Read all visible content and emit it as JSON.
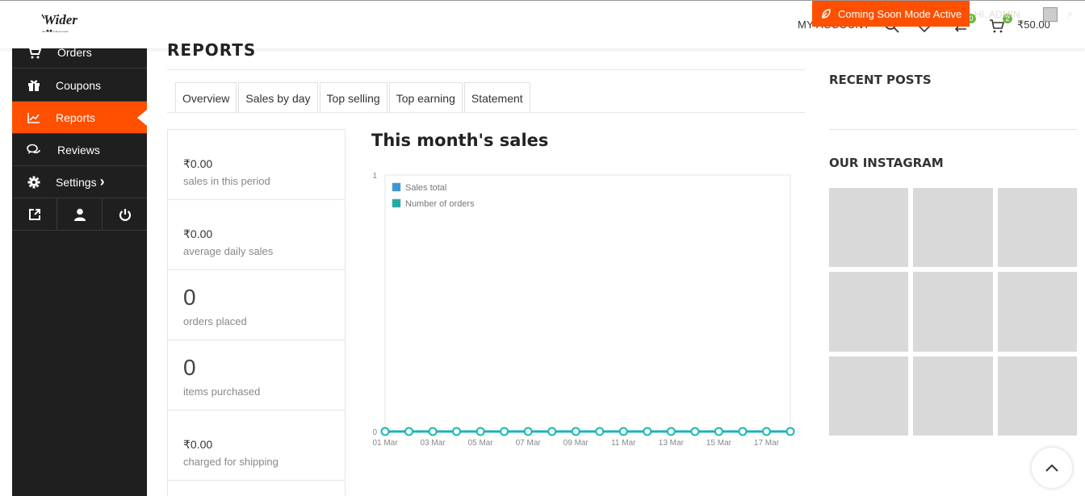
{
  "header": {
    "logo_text": "Wider",
    "logo_tagline": "All in one is all you need",
    "coming_soon": "Coming Soon Mode Active",
    "my_account": "MY ACCOUNT",
    "wishlist_count": "0",
    "cart_count": "2",
    "cart_total": "₹50.00",
    "ghost_text": "HI, ADMIN"
  },
  "sidebar": {
    "items": [
      {
        "label": "Orders",
        "icon": "cart-icon"
      },
      {
        "label": "Coupons",
        "icon": "gift-icon"
      },
      {
        "label": "Reports",
        "icon": "chart-line-icon",
        "active": true
      },
      {
        "label": "Reviews",
        "icon": "chat-icon"
      },
      {
        "label": "Settings",
        "icon": "gear-icon",
        "chevron": "›"
      }
    ],
    "bottom_icons": [
      "external-link-icon",
      "user-icon",
      "power-icon"
    ]
  },
  "page": {
    "title": "REPORTS",
    "tabs": [
      "Overview",
      "Sales by day",
      "Top selling",
      "Top earning",
      "Statement"
    ]
  },
  "stats": [
    {
      "value": "₹0.00",
      "label": "sales in this period"
    },
    {
      "value": "₹0.00",
      "label": "average daily sales"
    },
    {
      "value": "0",
      "label": "orders placed"
    },
    {
      "value": "0",
      "label": "items purchased"
    },
    {
      "value": "₹0.00",
      "label": "charged for shipping"
    }
  ],
  "chart_data": {
    "type": "line",
    "title": "This month's sales",
    "x": [
      "01 Mar",
      "02 Mar",
      "03 Mar",
      "04 Mar",
      "05 Mar",
      "06 Mar",
      "07 Mar",
      "08 Mar",
      "09 Mar",
      "10 Mar",
      "11 Mar",
      "12 Mar",
      "13 Mar",
      "14 Mar",
      "15 Mar",
      "16 Mar",
      "17 Mar",
      "18 Mar"
    ],
    "tick_labels": [
      "01 Mar",
      "03 Mar",
      "05 Mar",
      "07 Mar",
      "09 Mar",
      "11 Mar",
      "13 Mar",
      "15 Mar",
      "17 Mar"
    ],
    "ylim": [
      0,
      1
    ],
    "y_ticks": [
      "0",
      "1"
    ],
    "legend_position": "top-left",
    "series": [
      {
        "name": "Sales total",
        "color": "#3498db",
        "values": [
          0,
          0,
          0,
          0,
          0,
          0,
          0,
          0,
          0,
          0,
          0,
          0,
          0,
          0,
          0,
          0,
          0,
          0
        ]
      },
      {
        "name": "Number of orders",
        "color": "#1aafa8",
        "values": [
          0,
          0,
          0,
          0,
          0,
          0,
          0,
          0,
          0,
          0,
          0,
          0,
          0,
          0,
          0,
          0,
          0,
          0
        ]
      }
    ]
  },
  "right_sidebar": {
    "recent_posts": "RECENT POSTS",
    "instagram": "OUR INSTAGRAM",
    "instagram_tiles": 9
  },
  "colors": {
    "accent": "#ff4f00",
    "sidebar_bg": "#1f1f1f",
    "line": "#1ab5b5"
  }
}
